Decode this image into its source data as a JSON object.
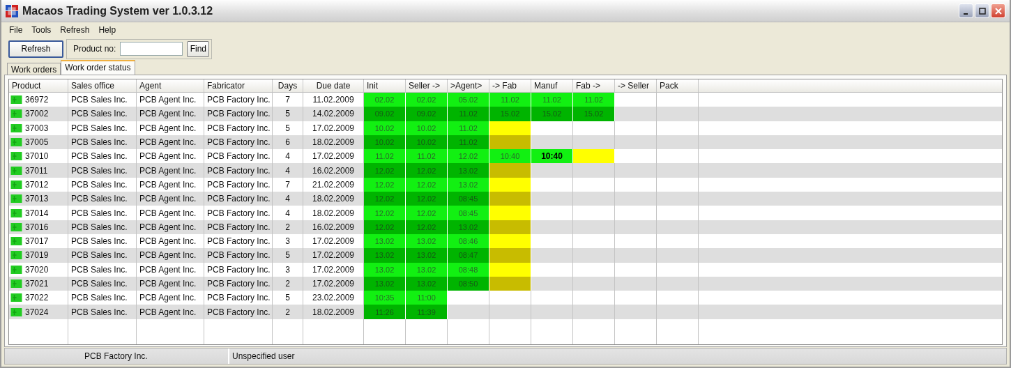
{
  "window": {
    "title": "Macaos Trading System ver 1.0.3.12"
  },
  "menu": [
    "File",
    "Tools",
    "Refresh",
    "Help"
  ],
  "toolbar": {
    "refresh_button": "Refresh",
    "product_label": "Product no:",
    "find_button": "Find"
  },
  "tabs": [
    {
      "label": "Work orders",
      "selected": false
    },
    {
      "label": "Work order status",
      "selected": true
    }
  ],
  "table": {
    "info_columns": [
      "Product",
      "Sales office",
      "Agent",
      "Fabricator",
      "Days",
      "Due date"
    ],
    "stage_columns": [
      "Init",
      "Seller ->",
      ">Agent>",
      "-> Fab",
      "Manuf",
      "Fab ->",
      "-> Seller",
      "Pack"
    ],
    "rows": [
      {
        "product": "36972",
        "sales_office": "PCB Sales Inc.",
        "agent": "PCB Agent Inc.",
        "fabricator": "PCB Factory Inc.",
        "days": "7",
        "due_date": "11.02.2009",
        "stages": [
          {
            "kind": "done",
            "text": "02.02"
          },
          {
            "kind": "done",
            "text": "02.02"
          },
          {
            "kind": "done",
            "text": "05.02"
          },
          {
            "kind": "done",
            "text": "11.02"
          },
          {
            "kind": "done",
            "text": "11.02"
          },
          {
            "kind": "done",
            "text": "11.02"
          }
        ]
      },
      {
        "product": "37002",
        "sales_office": "PCB Sales Inc.",
        "agent": "PCB Agent Inc.",
        "fabricator": "PCB Factory Inc.",
        "days": "5",
        "due_date": "14.02.2009",
        "stages": [
          {
            "kind": "done",
            "text": "09.02"
          },
          {
            "kind": "done",
            "text": "09.02"
          },
          {
            "kind": "done",
            "text": "11.02"
          },
          {
            "kind": "done",
            "text": "15.02"
          },
          {
            "kind": "done",
            "text": "15.02"
          },
          {
            "kind": "done",
            "text": "15.02"
          }
        ]
      },
      {
        "product": "37003",
        "sales_office": "PCB Sales Inc.",
        "agent": "PCB Agent Inc.",
        "fabricator": "PCB Factory Inc.",
        "days": "5",
        "due_date": "17.02.2009",
        "stages": [
          {
            "kind": "done",
            "text": "10.02"
          },
          {
            "kind": "done",
            "text": "10.02"
          },
          {
            "kind": "done",
            "text": "11.02"
          },
          {
            "kind": "waiting"
          }
        ]
      },
      {
        "product": "37005",
        "sales_office": "PCB Sales Inc.",
        "agent": "PCB Agent Inc.",
        "fabricator": "PCB Factory Inc.",
        "days": "6",
        "due_date": "18.02.2009",
        "stages": [
          {
            "kind": "done",
            "text": "10.02"
          },
          {
            "kind": "done",
            "text": "10.02"
          },
          {
            "kind": "done",
            "text": "11.02"
          },
          {
            "kind": "waiting"
          }
        ]
      },
      {
        "product": "37010",
        "sales_office": "PCB Sales Inc.",
        "agent": "PCB Agent Inc.",
        "fabricator": "PCB Factory Inc.",
        "days": "4",
        "due_date": "17.02.2009",
        "stages": [
          {
            "kind": "done",
            "text": "11.02"
          },
          {
            "kind": "done",
            "text": "11.02"
          },
          {
            "kind": "done",
            "text": "12.02"
          },
          {
            "kind": "done",
            "text": "10:40"
          },
          {
            "kind": "current",
            "text": "10:40"
          },
          {
            "kind": "waiting"
          }
        ]
      },
      {
        "product": "37011",
        "sales_office": "PCB Sales Inc.",
        "agent": "PCB Agent Inc.",
        "fabricator": "PCB Factory Inc.",
        "days": "4",
        "due_date": "16.02.2009",
        "stages": [
          {
            "kind": "done",
            "text": "12.02"
          },
          {
            "kind": "done",
            "text": "12.02"
          },
          {
            "kind": "done",
            "text": "13.02"
          },
          {
            "kind": "waiting"
          }
        ]
      },
      {
        "product": "37012",
        "sales_office": "PCB Sales Inc.",
        "agent": "PCB Agent Inc.",
        "fabricator": "PCB Factory Inc.",
        "days": "7",
        "due_date": "21.02.2009",
        "stages": [
          {
            "kind": "done",
            "text": "12.02"
          },
          {
            "kind": "done",
            "text": "12.02"
          },
          {
            "kind": "done",
            "text": "13.02"
          },
          {
            "kind": "waiting"
          }
        ]
      },
      {
        "product": "37013",
        "sales_office": "PCB Sales Inc.",
        "agent": "PCB Agent Inc.",
        "fabricator": "PCB Factory Inc.",
        "days": "4",
        "due_date": "18.02.2009",
        "stages": [
          {
            "kind": "done",
            "text": "12.02"
          },
          {
            "kind": "done",
            "text": "12.02"
          },
          {
            "kind": "done",
            "text": "08:45"
          },
          {
            "kind": "waiting"
          }
        ]
      },
      {
        "product": "37014",
        "sales_office": "PCB Sales Inc.",
        "agent": "PCB Agent Inc.",
        "fabricator": "PCB Factory Inc.",
        "days": "4",
        "due_date": "18.02.2009",
        "stages": [
          {
            "kind": "done",
            "text": "12.02"
          },
          {
            "kind": "done",
            "text": "12.02"
          },
          {
            "kind": "done",
            "text": "08:45"
          },
          {
            "kind": "waiting"
          }
        ]
      },
      {
        "product": "37016",
        "sales_office": "PCB Sales Inc.",
        "agent": "PCB Agent Inc.",
        "fabricator": "PCB Factory Inc.",
        "days": "2",
        "due_date": "16.02.2009",
        "stages": [
          {
            "kind": "done",
            "text": "12.02"
          },
          {
            "kind": "done",
            "text": "12.02"
          },
          {
            "kind": "done",
            "text": "13.02"
          },
          {
            "kind": "waiting"
          }
        ]
      },
      {
        "product": "37017",
        "sales_office": "PCB Sales Inc.",
        "agent": "PCB Agent Inc.",
        "fabricator": "PCB Factory Inc.",
        "days": "3",
        "due_date": "17.02.2009",
        "stages": [
          {
            "kind": "done",
            "text": "13.02"
          },
          {
            "kind": "done",
            "text": "13.02"
          },
          {
            "kind": "done",
            "text": "08:46"
          },
          {
            "kind": "waiting"
          }
        ]
      },
      {
        "product": "37019",
        "sales_office": "PCB Sales Inc.",
        "agent": "PCB Agent Inc.",
        "fabricator": "PCB Factory Inc.",
        "days": "5",
        "due_date": "17.02.2009",
        "stages": [
          {
            "kind": "done",
            "text": "13.02"
          },
          {
            "kind": "done",
            "text": "13.02"
          },
          {
            "kind": "done",
            "text": "08:47"
          },
          {
            "kind": "waiting"
          }
        ]
      },
      {
        "product": "37020",
        "sales_office": "PCB Sales Inc.",
        "agent": "PCB Agent Inc.",
        "fabricator": "PCB Factory Inc.",
        "days": "3",
        "due_date": "17.02.2009",
        "stages": [
          {
            "kind": "done",
            "text": "13.02"
          },
          {
            "kind": "done",
            "text": "13.02"
          },
          {
            "kind": "done",
            "text": "08:48"
          },
          {
            "kind": "waiting"
          }
        ]
      },
      {
        "product": "37021",
        "sales_office": "PCB Sales Inc.",
        "agent": "PCB Agent Inc.",
        "fabricator": "PCB Factory Inc.",
        "days": "2",
        "due_date": "17.02.2009",
        "stages": [
          {
            "kind": "done",
            "text": "13.02"
          },
          {
            "kind": "done",
            "text": "13.02"
          },
          {
            "kind": "done",
            "text": "08:50"
          },
          {
            "kind": "waiting"
          }
        ]
      },
      {
        "product": "37022",
        "sales_office": "PCB Sales Inc.",
        "agent": "PCB Agent Inc.",
        "fabricator": "PCB Factory Inc.",
        "days": "5",
        "due_date": "23.02.2009",
        "stages": [
          {
            "kind": "done",
            "text": "10:35"
          },
          {
            "kind": "done",
            "text": "11:00"
          }
        ]
      },
      {
        "product": "37024",
        "sales_office": "PCB Sales Inc.",
        "agent": "PCB Agent Inc.",
        "fabricator": "PCB Factory Inc.",
        "days": "2",
        "due_date": "18.02.2009",
        "stages": [
          {
            "kind": "done",
            "text": "11:26"
          },
          {
            "kind": "done",
            "text": "11:39"
          }
        ]
      }
    ]
  },
  "status_bar": [
    "PCB Factory Inc.",
    "Unspecified user"
  ]
}
